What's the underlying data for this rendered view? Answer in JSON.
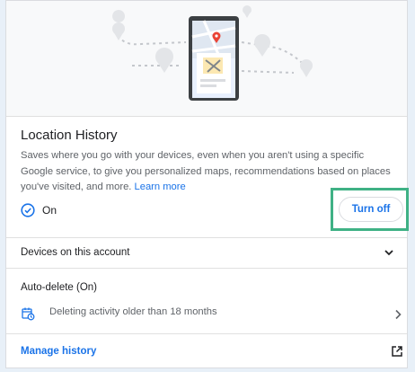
{
  "card": {
    "title": "Location History",
    "description": "Saves where you go with your devices, even when you aren't using a specific Google service, to give you personalized maps, recommendations based on places you've visited, and more.",
    "learn_more": "Learn more"
  },
  "status": {
    "label": "On",
    "icon": "check-circle-icon"
  },
  "turn_off_button": "Turn off",
  "devices": {
    "label": "Devices on this account",
    "icon": "chevron-down-icon"
  },
  "auto_delete": {
    "title": "Auto-delete (On)",
    "description": "Deleting activity older than 18 months",
    "icon": "calendar-delete-icon",
    "arrow": "chevron-right-icon"
  },
  "manage_history": {
    "label": "Manage history",
    "icon": "open-in-new-icon"
  },
  "colors": {
    "accent": "#1a73e8",
    "highlight": "#3fb185",
    "map_pin": "#ea4335"
  }
}
